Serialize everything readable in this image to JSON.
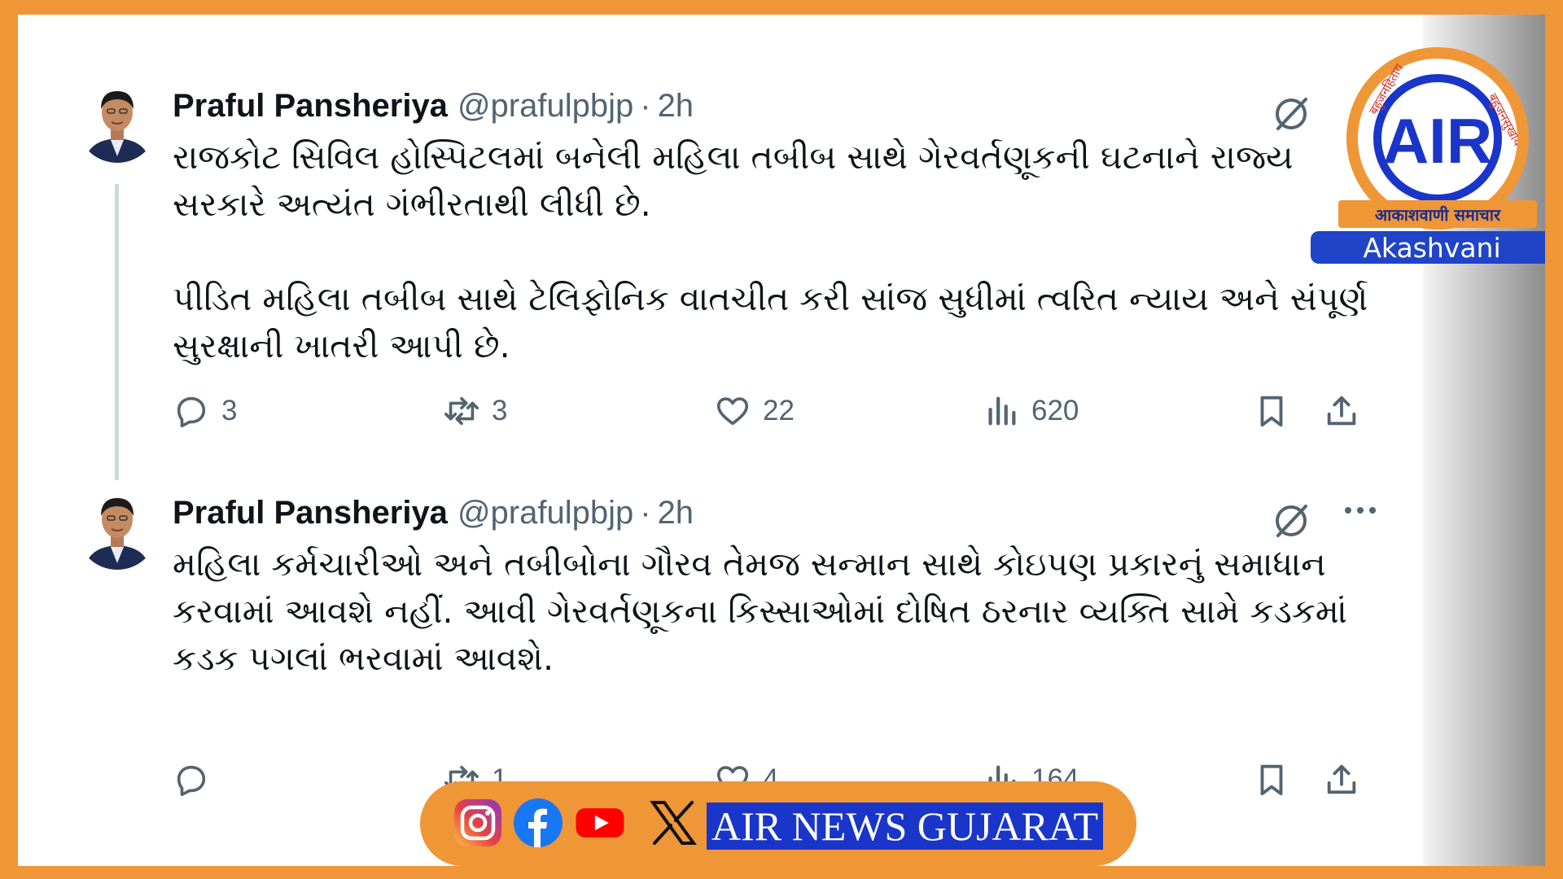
{
  "tweets": [
    {
      "author": "Praful Pansheriya",
      "handle": "@prafulpbjp",
      "separator": "·",
      "time": "2h",
      "paragraphs": [
        "રાજકોટ સિવિલ હોસ્પિટલમાં બનેલી મહિલા તબીબ સાથે ગેરવર્તણૂકની ઘટનાને રાજ્ય સરકારે અત્યંત ગંભીરતાથી લીધી છે.",
        "પીડિત મહિલા તબીબ સાથે ટેલિફોનિક વાતચીત કરી સાંજ સુધીમાં ત્વરિત ન્યાય અને સંપૂર્ણ સુરક્ષાની ખાતરી આપી છે."
      ],
      "replies": "3",
      "reposts": "3",
      "likes": "22",
      "views": "620"
    },
    {
      "author": "Praful Pansheriya",
      "handle": "@prafulpbjp",
      "separator": "·",
      "time": "2h",
      "paragraphs": [
        "મહિલા કર્મચારીઓ અને તબીબોના ગૌરવ તેમજ સન્માન સાથે કોઇપણ પ્રકારનું સમાધાન કરવામાં આવશે નહીં. આવી ગેરવર્તણૂકના કિસ્સાઓમાં દોષિત ઠરનાર વ્યક્તિ સામે કડકમાં કડક પગલાં ભરવામાં આવશે."
      ],
      "replies": "",
      "reposts": "1",
      "likes": "4",
      "views": "164"
    }
  ],
  "logo": {
    "letters": "AIR",
    "hindi_tagline": "आकाशवाणी समाचार",
    "name": "Akashvani",
    "ring_text_left": "बहुजनहिताय",
    "ring_text_right": "बहुजनसुखाय"
  },
  "footer": {
    "brand": "AIR NEWS GUJARAT",
    "icons": [
      "instagram-icon",
      "facebook-icon",
      "youtube-icon",
      "x-icon"
    ]
  },
  "colors": {
    "frame": "#ef9637",
    "text": "#0f1419",
    "muted": "#536471",
    "brand_blue": "#1a35c9"
  }
}
